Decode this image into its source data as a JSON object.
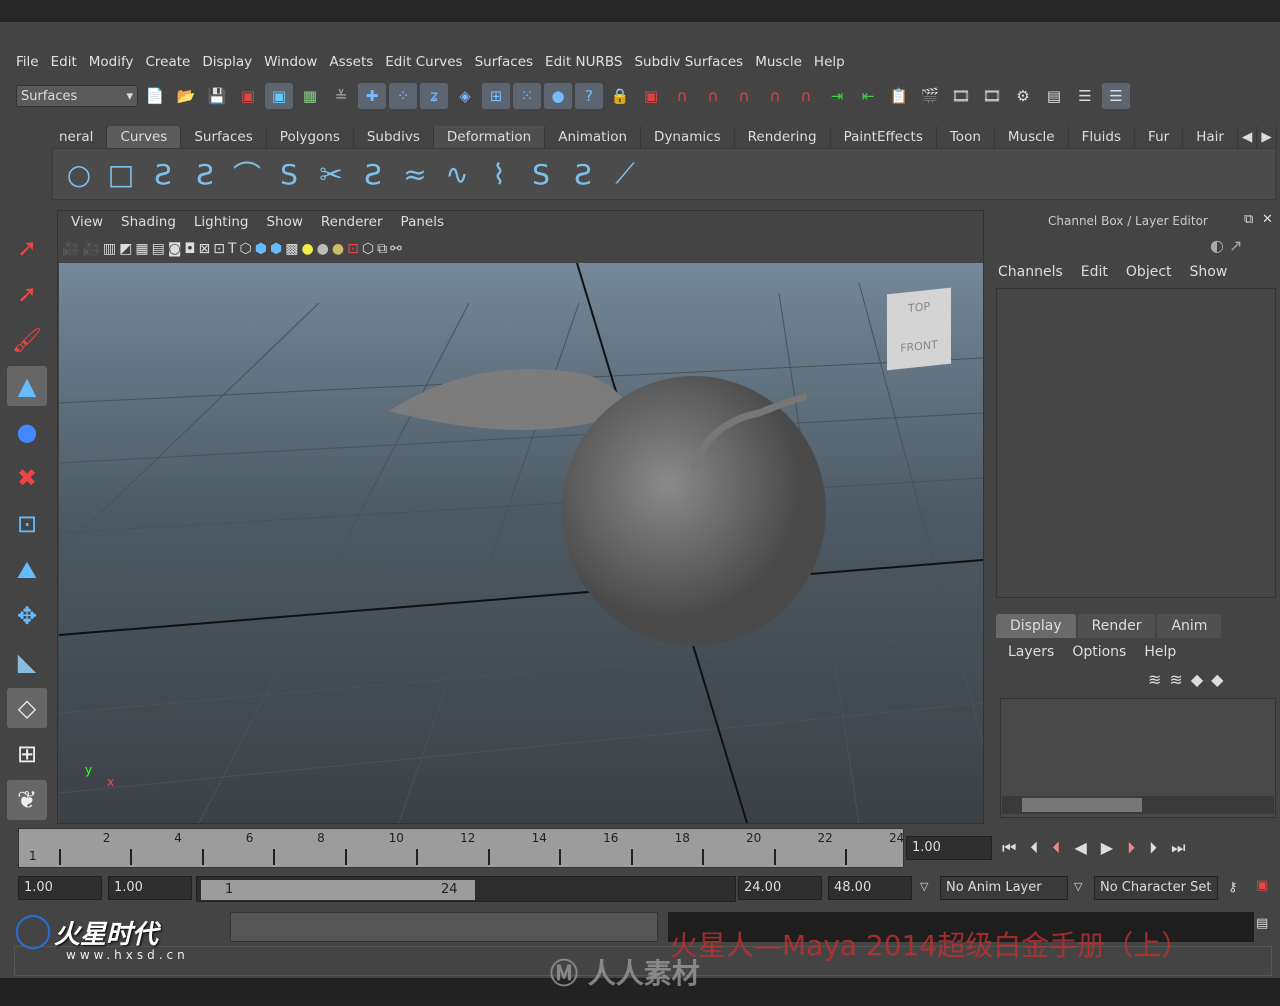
{
  "menubar": [
    "File",
    "Edit",
    "Modify",
    "Create",
    "Display",
    "Window",
    "Assets",
    "Edit Curves",
    "Surfaces",
    "Edit NURBS",
    "Subdiv Surfaces",
    "Muscle",
    "Help"
  ],
  "toolbar": {
    "menuset": "Surfaces"
  },
  "shelf_tabs": [
    "neral",
    "Curves",
    "Surfaces",
    "Polygons",
    "Subdivs",
    "Deformation",
    "Animation",
    "Dynamics",
    "Rendering",
    "PaintEffects",
    "Toon",
    "Muscle",
    "Fluids",
    "Fur",
    "Hair"
  ],
  "shelf_active": "Curves",
  "viewport": {
    "menu": [
      "View",
      "Shading",
      "Lighting",
      "Show",
      "Renderer",
      "Panels"
    ],
    "viewcube_top": "TOP",
    "viewcube_front": "FRONT",
    "axis_y": "y",
    "axis_x": "x"
  },
  "channel_box": {
    "title": "Channel Box / Layer Editor",
    "menu": [
      "Channels",
      "Edit",
      "Object",
      "Show"
    ]
  },
  "layer_editor": {
    "tabs": [
      "Display",
      "Render",
      "Anim"
    ],
    "menu": [
      "Layers",
      "Options",
      "Help"
    ]
  },
  "timeline": {
    "start": "1",
    "ticks": [
      "2",
      "4",
      "6",
      "8",
      "10",
      "12",
      "14",
      "16",
      "18",
      "20",
      "22",
      "24"
    ],
    "current_time": "1.00"
  },
  "range": {
    "start": "1.00",
    "playback_start": "1.00",
    "bar_start": "1",
    "bar_end": "24",
    "playback_end": "24.00",
    "end": "48.00",
    "anim_layer": "No Anim Layer",
    "character_set": "No Character Set"
  },
  "watermark": {
    "title": "火星人—Maya 2014超级白金手册（上）",
    "logo": "火星时代",
    "logo_url": "www.hxsd.cn",
    "rrsc": "人人素材"
  },
  "colors": {
    "bg": "#444444",
    "timeline": "#9c9c9c",
    "watermark": "#c03030"
  }
}
